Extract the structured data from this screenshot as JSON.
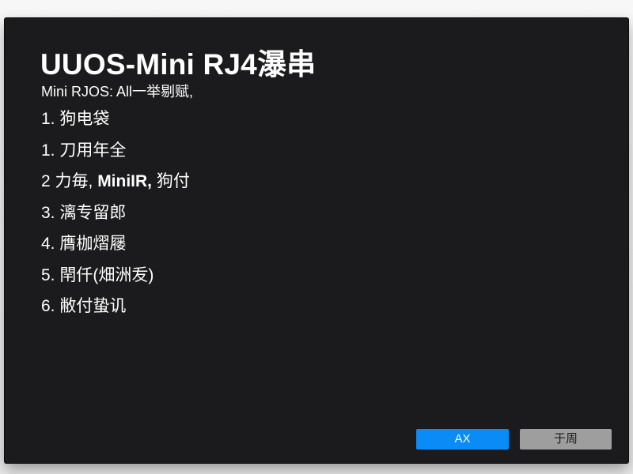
{
  "dialog": {
    "title": "UUOS-Mini RJ4瀑串",
    "subtitle": "Mini RJOS: All一举剔赋,",
    "steps": [
      {
        "prefix": "1. 狗电袋"
      },
      {
        "prefix": "1. 刀用年全"
      },
      {
        "prefix": "2 力毎, ",
        "highlight": "MiniIR,",
        "suffix": " 狗付"
      },
      {
        "prefix": "3. 漓专留郎"
      },
      {
        "prefix": "4. 膺枷熠屦"
      },
      {
        "prefix": "5. 閈仟(畑洲叐)"
      },
      {
        "prefix": "6. 敝付蛰讥"
      }
    ],
    "buttons": {
      "primary_label": "AX",
      "secondary_label": "于周"
    }
  }
}
